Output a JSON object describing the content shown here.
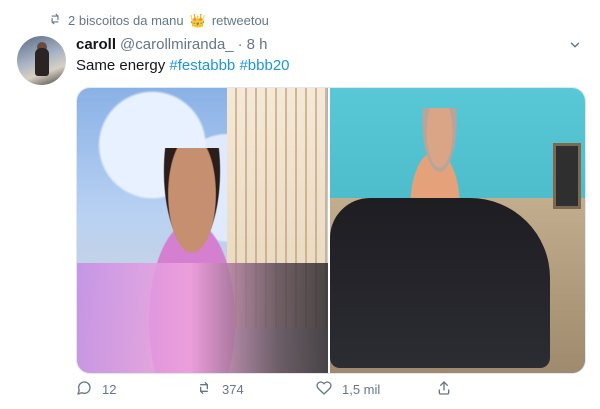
{
  "retweet_context": {
    "text": "2 biscoitos da manu",
    "emoji": "👑",
    "suffix": "retweetou"
  },
  "tweet": {
    "author_name": "caroll",
    "handle": "@carollmiranda_",
    "separator": "·",
    "time": "8 h",
    "text_prefix": "Same energy",
    "hashtags": [
      "#festabbb",
      "#bbb20"
    ]
  },
  "actions": {
    "replies": "12",
    "retweets": "374",
    "likes": "1,5 mil"
  },
  "icons": {
    "retweet_context": "retweet-icon",
    "reply": "reply-icon",
    "retweet": "retweet-icon",
    "like": "heart-icon",
    "share": "share-icon",
    "menu": "chevron-down-icon"
  },
  "colors": {
    "text_primary": "#14171a",
    "text_secondary": "#657786",
    "hashtag": "#1b95e0"
  }
}
